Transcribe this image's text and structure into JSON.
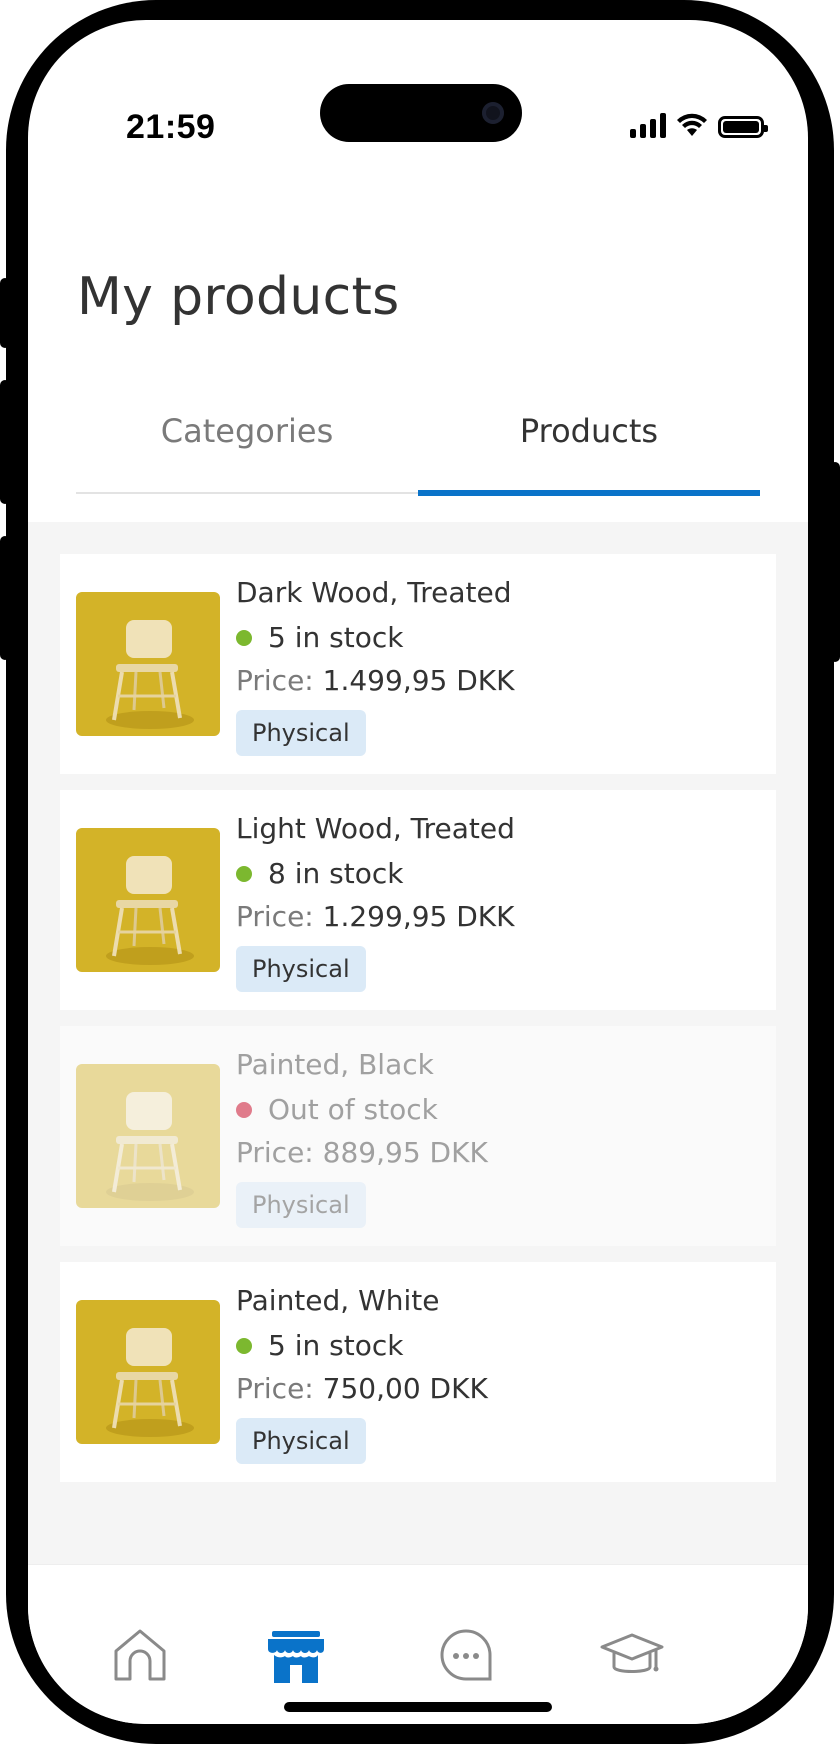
{
  "status_bar": {
    "time": "21:59"
  },
  "header": {
    "title": "My products"
  },
  "tabs": [
    {
      "label": "Categories",
      "active": false
    },
    {
      "label": "Products",
      "active": true
    }
  ],
  "products": [
    {
      "name": "Dark Wood, Treated",
      "stock": "5 in stock",
      "stock_status": "in",
      "price_label": "Price:",
      "price": "1.499,95 DKK",
      "badge": "Physical",
      "disabled": false
    },
    {
      "name": "Light Wood, Treated",
      "stock": "8 in stock",
      "stock_status": "in",
      "price_label": "Price:",
      "price": "1.299,95 DKK",
      "badge": "Physical",
      "disabled": false
    },
    {
      "name": "Painted, Black",
      "stock": "Out of stock",
      "stock_status": "out",
      "price_label": "Price:",
      "price": "889,95 DKK",
      "badge": "Physical",
      "disabled": true
    },
    {
      "name": "Painted, White",
      "stock": "5 in stock",
      "stock_status": "in",
      "price_label": "Price:",
      "price": "750,00 DKK",
      "badge": "Physical",
      "disabled": false
    }
  ],
  "bottom_nav": [
    {
      "icon": "home-icon",
      "active": false
    },
    {
      "icon": "store-icon",
      "active": true
    },
    {
      "icon": "chat-icon",
      "active": false
    },
    {
      "icon": "graduation-cap-icon",
      "active": false
    }
  ],
  "colors": {
    "accent": "#0a73c9",
    "in_stock": "#7cb82f",
    "out_of_stock": "#e07b8b",
    "badge_bg": "#dbeaf7",
    "thumb_bg": "#d3b328"
  }
}
